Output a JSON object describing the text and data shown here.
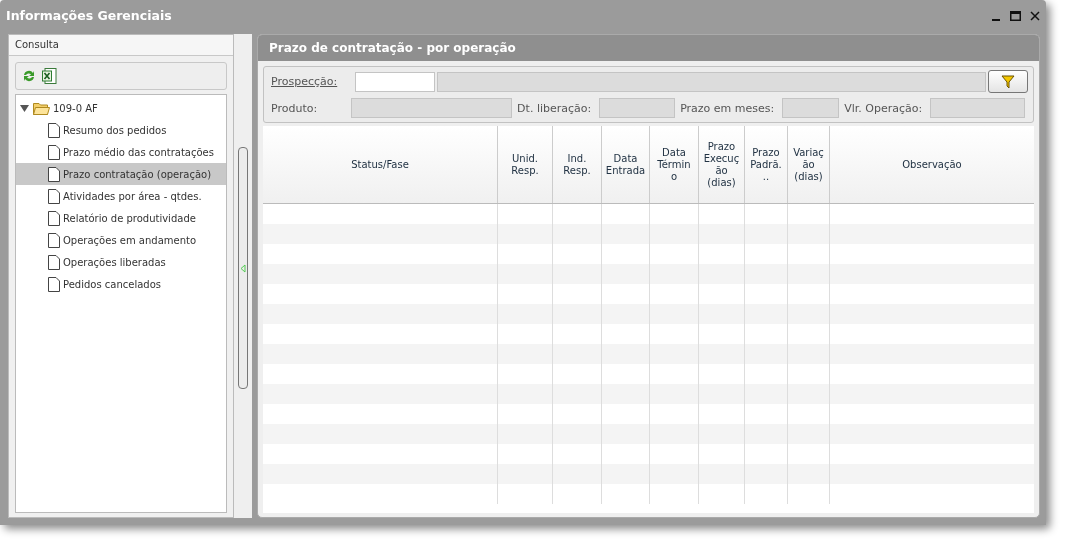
{
  "window": {
    "title": "Informações Gerenciais"
  },
  "sidebar": {
    "title": "Consulta",
    "tree": [
      {
        "label": "109-0 AF",
        "expanded": true,
        "children": [
          {
            "label": "Resumo dos pedidos",
            "selected": false
          },
          {
            "label": "Prazo médio das contratações",
            "selected": false
          },
          {
            "label": "Prazo contratação (operação)",
            "selected": true
          },
          {
            "label": "Atividades por área - qtdes.",
            "selected": false
          },
          {
            "label": "Relatório de produtividade",
            "selected": false
          },
          {
            "label": "Operações em andamento",
            "selected": false
          },
          {
            "label": "Operações liberadas",
            "selected": false
          },
          {
            "label": "Pedidos cancelados",
            "selected": false
          }
        ]
      }
    ]
  },
  "panel": {
    "title": "Prazo de contratação - por operação",
    "filters": {
      "prospeccao_label": "Prospecção:",
      "produto_label": "Produto:",
      "dt_liberacao_label": "Dt. liberação:",
      "prazo_meses_label": "Prazo em meses:",
      "vlr_operacao_label": "Vlr. Operação:"
    },
    "table": {
      "columns": [
        {
          "lines": [
            "Status/Fase"
          ]
        },
        {
          "lines": [
            "Unid.",
            "Resp."
          ]
        },
        {
          "lines": [
            "Ind.",
            "Resp."
          ]
        },
        {
          "lines": [
            "Data",
            "Entrada"
          ]
        },
        {
          "lines": [
            "Data",
            "Términ",
            "o"
          ]
        },
        {
          "lines": [
            "Prazo",
            "Execuç",
            "ão",
            "(dias)"
          ]
        },
        {
          "lines": [
            "Prazo",
            "Padrã.",
            ".."
          ]
        },
        {
          "lines": [
            "Variaç",
            "ão",
            "(dias)"
          ]
        },
        {
          "lines": [
            "Observação"
          ]
        }
      ]
    }
  }
}
